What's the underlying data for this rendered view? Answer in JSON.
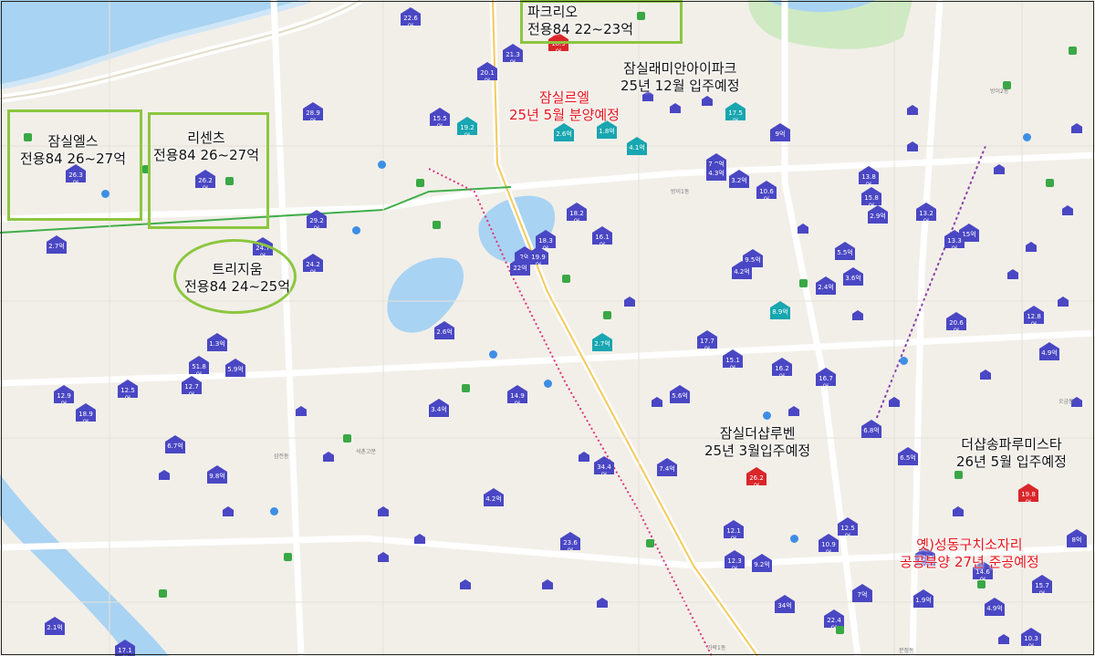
{
  "map": {
    "annotations": [
      {
        "id": "park-rio",
        "lines": [
          "파크리오",
          "전용84 22~23억"
        ],
        "color": "black",
        "frame": "box"
      },
      {
        "id": "jamsil-els",
        "lines": [
          "잠실엘스",
          "전용84 26~27억"
        ],
        "color": "black",
        "frame": "box"
      },
      {
        "id": "ricenz",
        "lines": [
          "리센츠",
          "전용84 26~27억"
        ],
        "color": "black",
        "frame": "box"
      },
      {
        "id": "trizium",
        "lines": [
          "트리지움",
          "전용84 24~25억"
        ],
        "color": "black",
        "frame": "ellipse"
      },
      {
        "id": "jamsil-raemian-i-park",
        "lines": [
          "잠실래미안아이파크",
          "25년 12월 입주예정"
        ],
        "color": "black",
        "frame": "none"
      },
      {
        "id": "jamsil-le-el",
        "lines": [
          "잠실르엘",
          "25년 5월 분양예정"
        ],
        "color": "red",
        "frame": "none"
      },
      {
        "id": "jamsil-the-sharp-ruben",
        "lines": [
          "잠실더샵루벤",
          "25년 3월입주예정"
        ],
        "color": "black",
        "frame": "none"
      },
      {
        "id": "the-sharp-songpa-lumistar",
        "lines": [
          "더샵송파루미스타",
          "26년 5월 입주예정"
        ],
        "color": "black",
        "frame": "none"
      },
      {
        "id": "old-seongdong-detention",
        "lines": [
          "옛)성동구치소자리",
          "공공분양 27년 준공예정"
        ],
        "color": "red",
        "frame": "none"
      }
    ],
    "price_markers": [
      {
        "label": "22.6억",
        "kind": "blue"
      },
      {
        "label": "21.3억",
        "kind": "blue"
      },
      {
        "label": "20.1억",
        "kind": "blue"
      },
      {
        "label": "18.9억",
        "kind": "red"
      },
      {
        "label": "28.9억",
        "kind": "blue"
      },
      {
        "label": "15.5억",
        "kind": "blue"
      },
      {
        "label": "19.2억",
        "kind": "teal"
      },
      {
        "label": "2.6억",
        "kind": "teal"
      },
      {
        "label": "1.8억",
        "kind": "teal"
      },
      {
        "label": "4.1억",
        "kind": "teal"
      },
      {
        "label": "17.5억",
        "kind": "teal"
      },
      {
        "label": "9억",
        "kind": "blue"
      },
      {
        "label": "26.3억",
        "kind": "blue"
      },
      {
        "label": "26.2억",
        "kind": "blue"
      },
      {
        "label": "7.8억",
        "kind": "blue"
      },
      {
        "label": "4.3억",
        "kind": "blue"
      },
      {
        "label": "3.2억",
        "kind": "blue"
      },
      {
        "label": "10.6억",
        "kind": "blue"
      },
      {
        "label": "13.8억",
        "kind": "blue"
      },
      {
        "label": "15.8억",
        "kind": "blue"
      },
      {
        "label": "2.9억",
        "kind": "blue"
      },
      {
        "label": "13.2억",
        "kind": "blue"
      },
      {
        "label": "18.2억",
        "kind": "blue"
      },
      {
        "label": "16.1억",
        "kind": "blue"
      },
      {
        "label": "18.3억",
        "kind": "blue"
      },
      {
        "label": "2억",
        "kind": "blue"
      },
      {
        "label": "24.2억",
        "kind": "blue"
      },
      {
        "label": "29.2억",
        "kind": "blue"
      },
      {
        "label": "2.7억",
        "kind": "blue"
      },
      {
        "label": "24.7억",
        "kind": "blue"
      },
      {
        "label": "22억",
        "kind": "blue"
      },
      {
        "label": "19.9억",
        "kind": "blue"
      },
      {
        "label": "15억",
        "kind": "blue"
      },
      {
        "label": "5.5억",
        "kind": "blue"
      },
      {
        "label": "13.3억",
        "kind": "blue"
      },
      {
        "label": "9.5억",
        "kind": "blue"
      },
      {
        "label": "4.2억",
        "kind": "blue"
      },
      {
        "label": "3.6억",
        "kind": "blue"
      },
      {
        "label": "2.4억",
        "kind": "blue"
      },
      {
        "label": "8.9억",
        "kind": "teal"
      },
      {
        "label": "20.6억",
        "kind": "blue"
      },
      {
        "label": "12.8억",
        "kind": "blue"
      },
      {
        "label": "2.6억",
        "kind": "blue"
      },
      {
        "label": "2.7억",
        "kind": "teal"
      },
      {
        "label": "17.7억",
        "kind": "blue"
      },
      {
        "label": "15.1억",
        "kind": "blue"
      },
      {
        "label": "16.2억",
        "kind": "blue"
      },
      {
        "label": "16.7억",
        "kind": "blue"
      },
      {
        "label": "4.9억",
        "kind": "blue"
      },
      {
        "label": "1.3억",
        "kind": "blue"
      },
      {
        "label": "51.8억",
        "kind": "blue"
      },
      {
        "label": "5.9억",
        "kind": "blue"
      },
      {
        "label": "12.7억",
        "kind": "blue"
      },
      {
        "label": "12.9억",
        "kind": "blue"
      },
      {
        "label": "12.5억",
        "kind": "blue"
      },
      {
        "label": "18.9억",
        "kind": "blue"
      },
      {
        "label": "14.9억",
        "kind": "blue"
      },
      {
        "label": "3.4억",
        "kind": "blue"
      },
      {
        "label": "5.6억",
        "kind": "blue"
      },
      {
        "label": "6.8억",
        "kind": "blue"
      },
      {
        "label": "6.7억",
        "kind": "blue"
      },
      {
        "label": "9.8억",
        "kind": "blue"
      },
      {
        "label": "34.4억",
        "kind": "blue"
      },
      {
        "label": "7.4억",
        "kind": "blue"
      },
      {
        "label": "26.2억",
        "kind": "red"
      },
      {
        "label": "6.5억",
        "kind": "blue"
      },
      {
        "label": "19.8억",
        "kind": "red"
      },
      {
        "label": "12.1억",
        "kind": "blue"
      },
      {
        "label": "12.3억",
        "kind": "blue"
      },
      {
        "label": "10.9억",
        "kind": "blue"
      },
      {
        "label": "12.5억",
        "kind": "blue"
      },
      {
        "label": "9.2억",
        "kind": "blue"
      },
      {
        "label": "23.6억",
        "kind": "blue"
      },
      {
        "label": "4.2억",
        "kind": "blue"
      },
      {
        "label": "12.4억",
        "kind": "blue"
      },
      {
        "label": "14.6억",
        "kind": "blue"
      },
      {
        "label": "15.7억",
        "kind": "blue"
      },
      {
        "label": "2.1억",
        "kind": "blue"
      },
      {
        "label": "17.1억",
        "kind": "blue"
      },
      {
        "label": "10.3억",
        "kind": "blue"
      },
      {
        "label": "34억",
        "kind": "blue"
      },
      {
        "label": "22.4억",
        "kind": "blue"
      },
      {
        "label": "4.9억",
        "kind": "blue"
      },
      {
        "label": "1.9억",
        "kind": "blue"
      },
      {
        "label": "7억",
        "kind": "blue"
      },
      {
        "label": "8억",
        "kind": "blue"
      },
      {
        "label": "3.2억",
        "kind": "blue"
      }
    ],
    "place_labels": [
      "방이1동",
      "가락1동",
      "오금동",
      "삼전동",
      "석촌고분",
      "방이2동",
      "문정동"
    ]
  }
}
